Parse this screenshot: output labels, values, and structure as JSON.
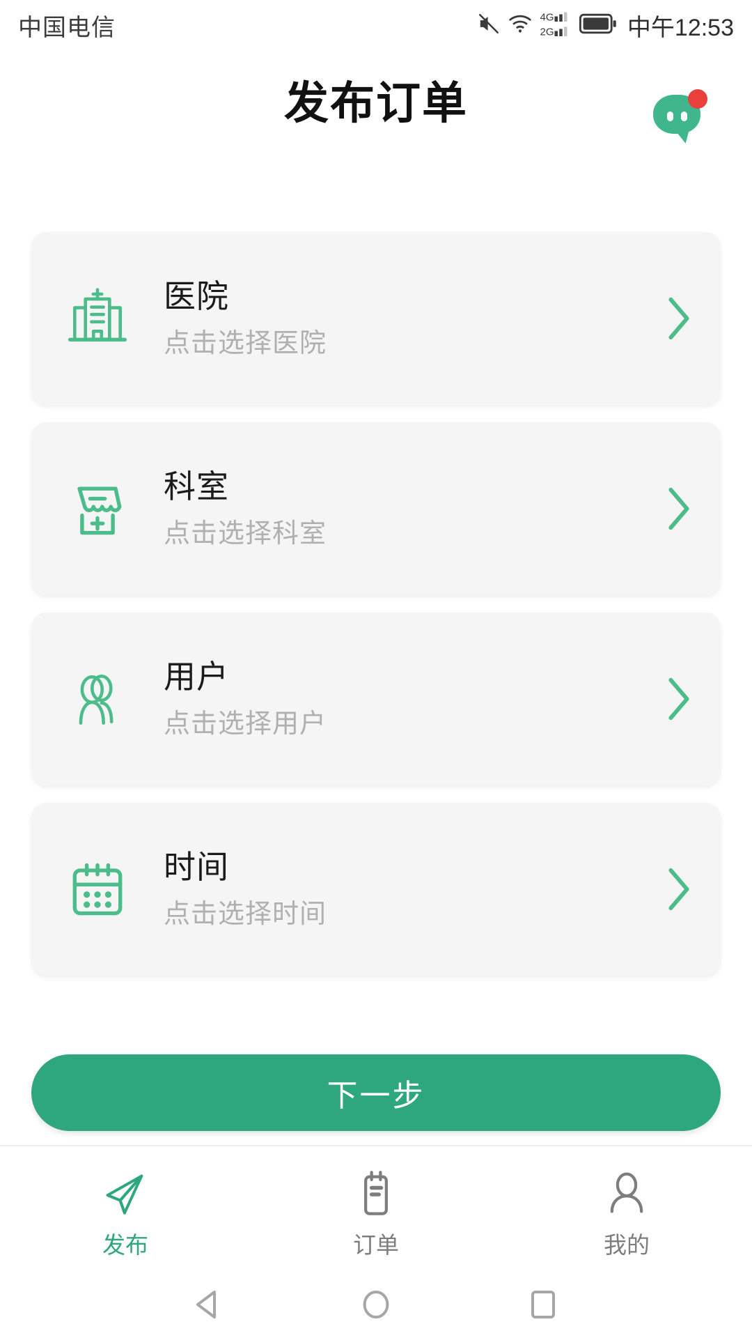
{
  "statusbar": {
    "carrier": "中国电信",
    "clock": "中午12:53",
    "icons": [
      "mute-icon",
      "wifi-icon",
      "signal-4g-icon",
      "signal-2g-icon",
      "battery-icon"
    ]
  },
  "header": {
    "title": "发布订单",
    "chat_icon": "chat-bubble-icon",
    "chat_badge": true
  },
  "colors": {
    "accent_green": "#2fa77e",
    "icon_green": "#4cbc8a",
    "card_bg": "#f5f5f5",
    "badge_red": "#e9403c",
    "muted_text": "#b0b0b0"
  },
  "cards": [
    {
      "icon": "hospital-building-icon",
      "title": "医院",
      "subtitle": "点击选择医院",
      "chevron": "chevron-right-icon"
    },
    {
      "icon": "clinic-storefront-icon",
      "title": "科室",
      "subtitle": "点击选择科室",
      "chevron": "chevron-right-icon"
    },
    {
      "icon": "users-group-icon",
      "title": "用户",
      "subtitle": "点击选择用户",
      "chevron": "chevron-right-icon"
    },
    {
      "icon": "calendar-icon",
      "title": "时间",
      "subtitle": "点击选择时间",
      "chevron": "chevron-right-icon"
    }
  ],
  "primary_button": {
    "label": "下一步"
  },
  "tabbar": [
    {
      "icon": "paper-plane-icon",
      "label": "发布",
      "active": true
    },
    {
      "icon": "clipboard-icon",
      "label": "订单",
      "active": false
    },
    {
      "icon": "person-icon",
      "label": "我的",
      "active": false
    }
  ],
  "navbar": [
    {
      "icon": "back-triangle-icon"
    },
    {
      "icon": "home-circle-icon"
    },
    {
      "icon": "recents-square-icon"
    }
  ]
}
